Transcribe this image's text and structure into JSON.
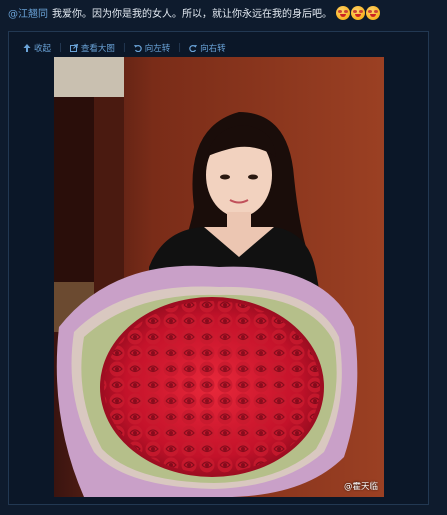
{
  "post": {
    "mention": "@江翘同",
    "text": "我爱你。因为你是我的女人。所以，就让你永远在我的身后吧。",
    "emoji_count": 3
  },
  "toolbar": {
    "collapse": "收起",
    "view_large": "查看大图",
    "rotate_left": "向左转",
    "rotate_right": "向右转"
  },
  "image": {
    "watermark": "@霍天临",
    "description_icon": "photo-woman-roses"
  },
  "colors": {
    "background": "#0e1b2d",
    "link": "#6aa3d8",
    "card_border": "#223852"
  }
}
